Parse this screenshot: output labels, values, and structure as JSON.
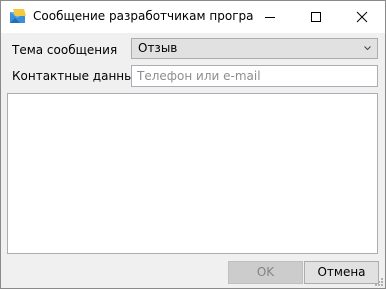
{
  "window": {
    "title": "Сообщение разработчикам програм...",
    "app_icon": "envelope-icon",
    "controls": {
      "minimize": "minimize-icon",
      "maximize": "maximize-icon",
      "close": "close-icon"
    }
  },
  "form": {
    "subject_label": "Тема сообщения",
    "subject_value": "Отзыв",
    "contact_label": "Контактные данные",
    "contact_value": "",
    "contact_placeholder": "Телефон или e-mail",
    "message_value": ""
  },
  "buttons": {
    "ok_label": "OK",
    "ok_enabled": false,
    "cancel_label": "Отмена"
  },
  "colors": {
    "window_bg": "#f0f0f0",
    "titlebar_bg": "#ffffff",
    "button_bg": "#e1e1e1",
    "disabled_text": "#838383"
  }
}
